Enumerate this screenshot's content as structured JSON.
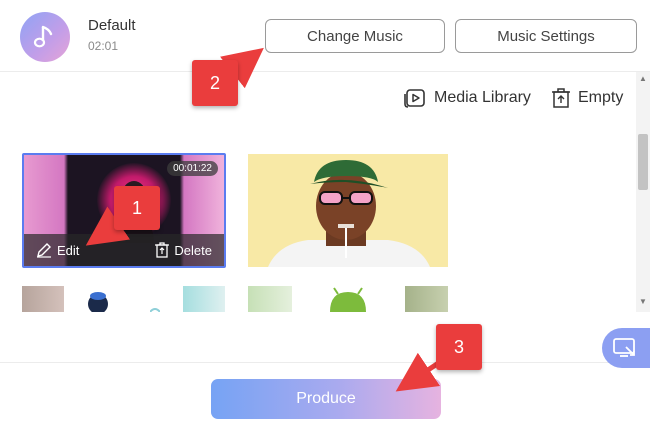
{
  "header": {
    "track_title": "Default",
    "track_time": "02:01",
    "music_icon": "music-note-icon",
    "change_music_label": "Change Music",
    "music_settings_label": "Music Settings"
  },
  "toolbar": {
    "media_library_label": "Media Library",
    "media_library_icon": "media-library-icon",
    "empty_label": "Empty",
    "empty_icon": "trash-icon"
  },
  "clips": [
    {
      "duration": "00:01:22",
      "edit_label": "Edit",
      "delete_label": "Delete",
      "selected": true
    },
    {
      "duration": "",
      "selected": false
    }
  ],
  "annotations": {
    "badge1": "1",
    "badge2": "2",
    "badge3": "3",
    "color": "#ea3d3d"
  },
  "footer": {
    "produce_label": "Produce",
    "side_icon": "screen-record-icon"
  },
  "colors": {
    "accent_blue": "#5b7cf0",
    "produce_gradient_start": "#76a3f4",
    "produce_gradient_end": "#e6b3e0"
  }
}
